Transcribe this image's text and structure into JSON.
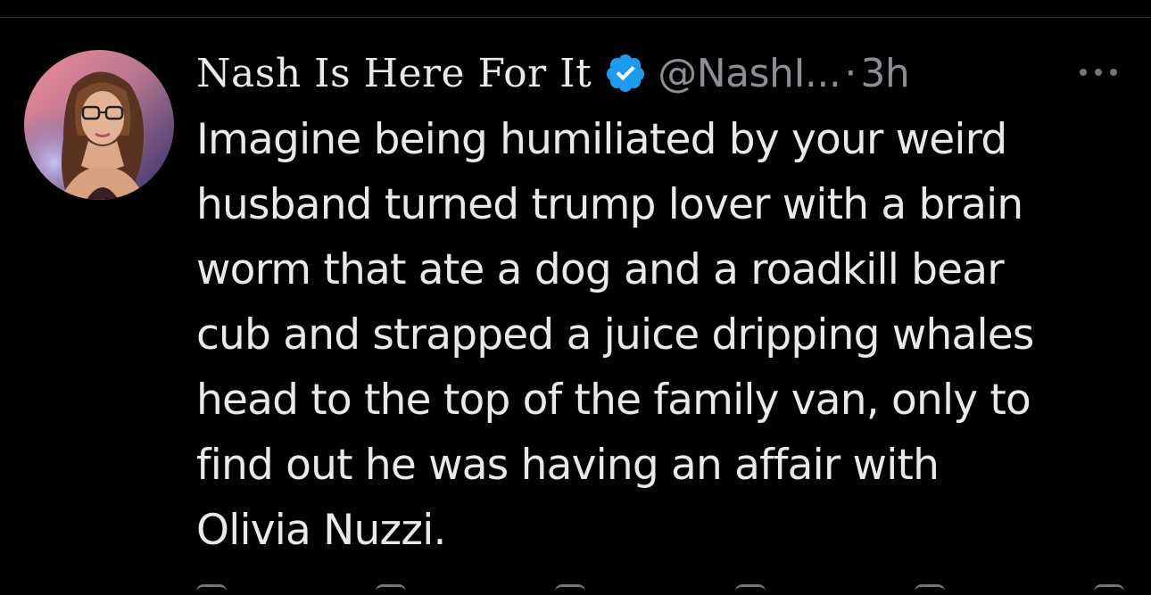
{
  "tweet": {
    "display_name": "Nash Is Here For It",
    "handle": "@NashI...",
    "separator": "·",
    "time": "3h",
    "body": "Imagine being humiliated by your weird\nhusband turned trump lover with a brain\nworm that ate a dog and a roadkill bear\ncub and strapped a juice dripping whales\nhead to the top of the family van, only to\nfind out he was having an affair with\nOlivia Nuzzi.",
    "verified": true
  },
  "icons": {
    "verified": "verified-badge-icon",
    "more": "more-options-icon",
    "actions": [
      "reply-icon",
      "repost-icon",
      "like-icon",
      "views-icon",
      "bookmark-icon",
      "share-icon"
    ]
  },
  "colors": {
    "background": "#000000",
    "text": "#e7e9ea",
    "secondary_text": "#8b8f94",
    "verified_blue": "#1d9bf0",
    "divider": "#2f3336"
  }
}
